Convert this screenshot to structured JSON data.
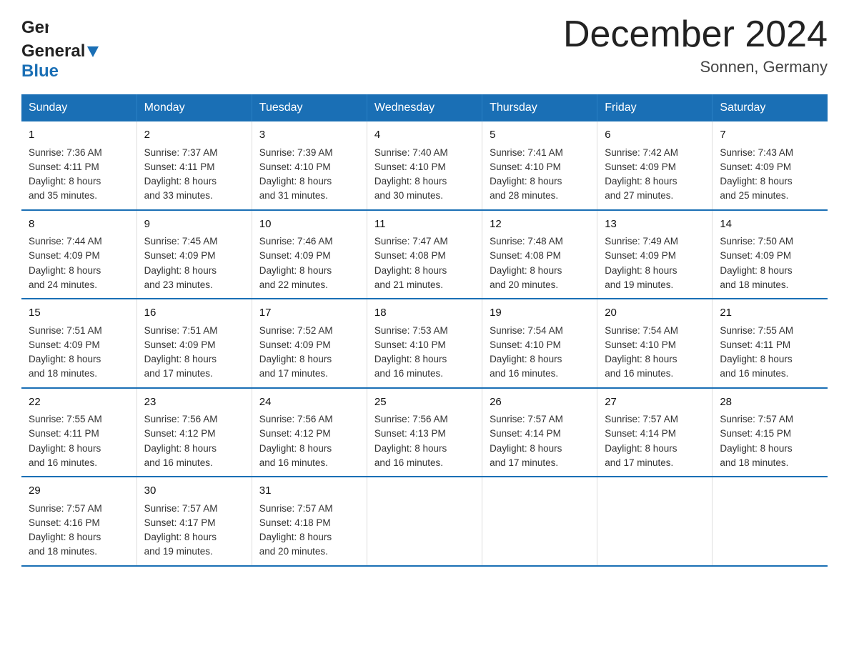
{
  "logo": {
    "general": "General",
    "blue": "Blue"
  },
  "title": "December 2024",
  "subtitle": "Sonnen, Germany",
  "weekdays": [
    "Sunday",
    "Monday",
    "Tuesday",
    "Wednesday",
    "Thursday",
    "Friday",
    "Saturday"
  ],
  "weeks": [
    [
      {
        "day": "1",
        "sunrise": "7:36 AM",
        "sunset": "4:11 PM",
        "daylight": "8 hours and 35 minutes."
      },
      {
        "day": "2",
        "sunrise": "7:37 AM",
        "sunset": "4:11 PM",
        "daylight": "8 hours and 33 minutes."
      },
      {
        "day": "3",
        "sunrise": "7:39 AM",
        "sunset": "4:10 PM",
        "daylight": "8 hours and 31 minutes."
      },
      {
        "day": "4",
        "sunrise": "7:40 AM",
        "sunset": "4:10 PM",
        "daylight": "8 hours and 30 minutes."
      },
      {
        "day": "5",
        "sunrise": "7:41 AM",
        "sunset": "4:10 PM",
        "daylight": "8 hours and 28 minutes."
      },
      {
        "day": "6",
        "sunrise": "7:42 AM",
        "sunset": "4:09 PM",
        "daylight": "8 hours and 27 minutes."
      },
      {
        "day": "7",
        "sunrise": "7:43 AM",
        "sunset": "4:09 PM",
        "daylight": "8 hours and 25 minutes."
      }
    ],
    [
      {
        "day": "8",
        "sunrise": "7:44 AM",
        "sunset": "4:09 PM",
        "daylight": "8 hours and 24 minutes."
      },
      {
        "day": "9",
        "sunrise": "7:45 AM",
        "sunset": "4:09 PM",
        "daylight": "8 hours and 23 minutes."
      },
      {
        "day": "10",
        "sunrise": "7:46 AM",
        "sunset": "4:09 PM",
        "daylight": "8 hours and 22 minutes."
      },
      {
        "day": "11",
        "sunrise": "7:47 AM",
        "sunset": "4:08 PM",
        "daylight": "8 hours and 21 minutes."
      },
      {
        "day": "12",
        "sunrise": "7:48 AM",
        "sunset": "4:08 PM",
        "daylight": "8 hours and 20 minutes."
      },
      {
        "day": "13",
        "sunrise": "7:49 AM",
        "sunset": "4:09 PM",
        "daylight": "8 hours and 19 minutes."
      },
      {
        "day": "14",
        "sunrise": "7:50 AM",
        "sunset": "4:09 PM",
        "daylight": "8 hours and 18 minutes."
      }
    ],
    [
      {
        "day": "15",
        "sunrise": "7:51 AM",
        "sunset": "4:09 PM",
        "daylight": "8 hours and 18 minutes."
      },
      {
        "day": "16",
        "sunrise": "7:51 AM",
        "sunset": "4:09 PM",
        "daylight": "8 hours and 17 minutes."
      },
      {
        "day": "17",
        "sunrise": "7:52 AM",
        "sunset": "4:09 PM",
        "daylight": "8 hours and 17 minutes."
      },
      {
        "day": "18",
        "sunrise": "7:53 AM",
        "sunset": "4:10 PM",
        "daylight": "8 hours and 16 minutes."
      },
      {
        "day": "19",
        "sunrise": "7:54 AM",
        "sunset": "4:10 PM",
        "daylight": "8 hours and 16 minutes."
      },
      {
        "day": "20",
        "sunrise": "7:54 AM",
        "sunset": "4:10 PM",
        "daylight": "8 hours and 16 minutes."
      },
      {
        "day": "21",
        "sunrise": "7:55 AM",
        "sunset": "4:11 PM",
        "daylight": "8 hours and 16 minutes."
      }
    ],
    [
      {
        "day": "22",
        "sunrise": "7:55 AM",
        "sunset": "4:11 PM",
        "daylight": "8 hours and 16 minutes."
      },
      {
        "day": "23",
        "sunrise": "7:56 AM",
        "sunset": "4:12 PM",
        "daylight": "8 hours and 16 minutes."
      },
      {
        "day": "24",
        "sunrise": "7:56 AM",
        "sunset": "4:12 PM",
        "daylight": "8 hours and 16 minutes."
      },
      {
        "day": "25",
        "sunrise": "7:56 AM",
        "sunset": "4:13 PM",
        "daylight": "8 hours and 16 minutes."
      },
      {
        "day": "26",
        "sunrise": "7:57 AM",
        "sunset": "4:14 PM",
        "daylight": "8 hours and 17 minutes."
      },
      {
        "day": "27",
        "sunrise": "7:57 AM",
        "sunset": "4:14 PM",
        "daylight": "8 hours and 17 minutes."
      },
      {
        "day": "28",
        "sunrise": "7:57 AM",
        "sunset": "4:15 PM",
        "daylight": "8 hours and 18 minutes."
      }
    ],
    [
      {
        "day": "29",
        "sunrise": "7:57 AM",
        "sunset": "4:16 PM",
        "daylight": "8 hours and 18 minutes."
      },
      {
        "day": "30",
        "sunrise": "7:57 AM",
        "sunset": "4:17 PM",
        "daylight": "8 hours and 19 minutes."
      },
      {
        "day": "31",
        "sunrise": "7:57 AM",
        "sunset": "4:18 PM",
        "daylight": "8 hours and 20 minutes."
      },
      null,
      null,
      null,
      null
    ]
  ],
  "labels": {
    "sunrise": "Sunrise:",
    "sunset": "Sunset:",
    "daylight": "Daylight:"
  }
}
